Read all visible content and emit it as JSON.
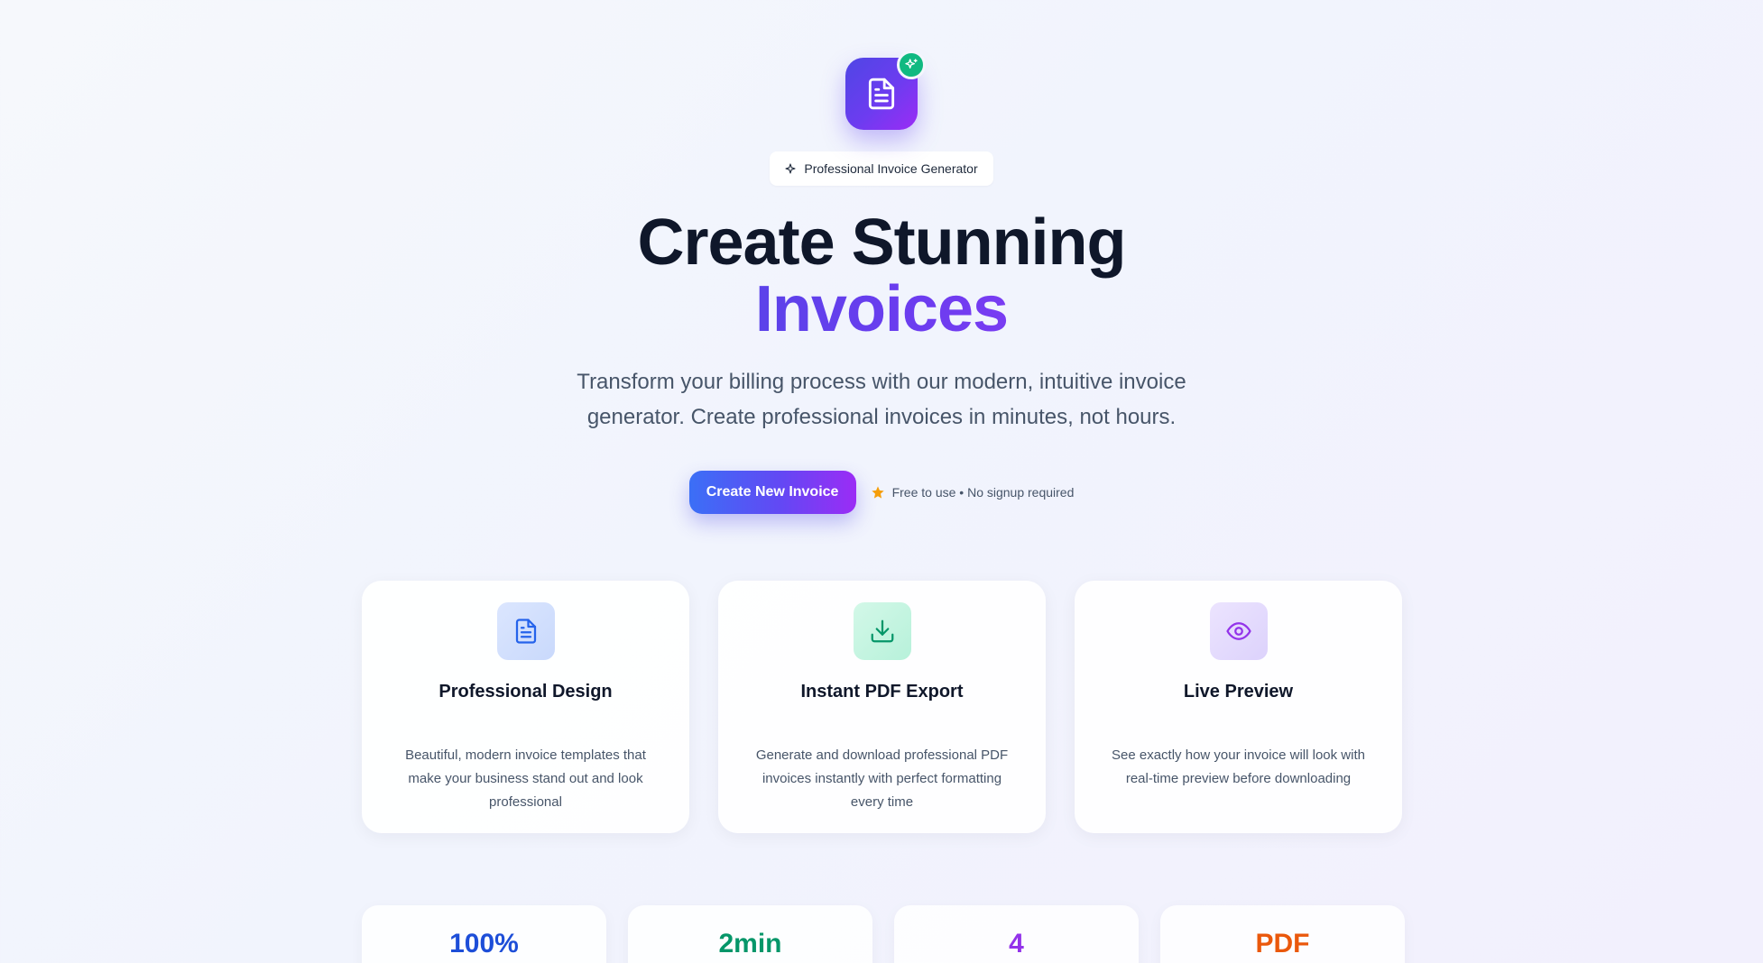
{
  "hero": {
    "logo_icon": "document-icon",
    "badge_icon": "sparkles-icon",
    "pill_icon": "sparkle-icon",
    "pill_label": "Professional Invoice Generator",
    "headline_line1": "Create Stunning",
    "headline_line2": "Invoices",
    "subtitle": "Transform your billing process with our modern, intuitive invoice generator. Create professional invoices in minutes, not hours.",
    "cta_label": "Create New Invoice",
    "note_icon": "star-icon",
    "note_text": "Free to use • No signup required"
  },
  "features": [
    {
      "icon": "document-icon",
      "title": "Professional Design",
      "description": "Beautiful, modern invoice templates that make your business stand out and look professional",
      "accent": "#2563eb"
    },
    {
      "icon": "download-icon",
      "title": "Instant PDF Export",
      "description": "Generate and download professional PDF invoices instantly with perfect formatting every time",
      "accent": "#059669"
    },
    {
      "icon": "eye-icon",
      "title": "Live Preview",
      "description": "See exactly how your invoice will look with real-time preview before downloading",
      "accent": "#9333ea"
    }
  ],
  "stats": [
    {
      "value": "100%",
      "color": "#1d4ed8"
    },
    {
      "value": "2min",
      "color": "#059669"
    },
    {
      "value": "4",
      "color": "#9333ea"
    },
    {
      "value": "PDF",
      "color": "#ea580c"
    }
  ],
  "colors": {
    "brand_gradient_start": "#3b6ff6",
    "brand_gradient_end": "#9b2cf5",
    "badge_green": "#10b981",
    "star": "#f59e0b"
  }
}
